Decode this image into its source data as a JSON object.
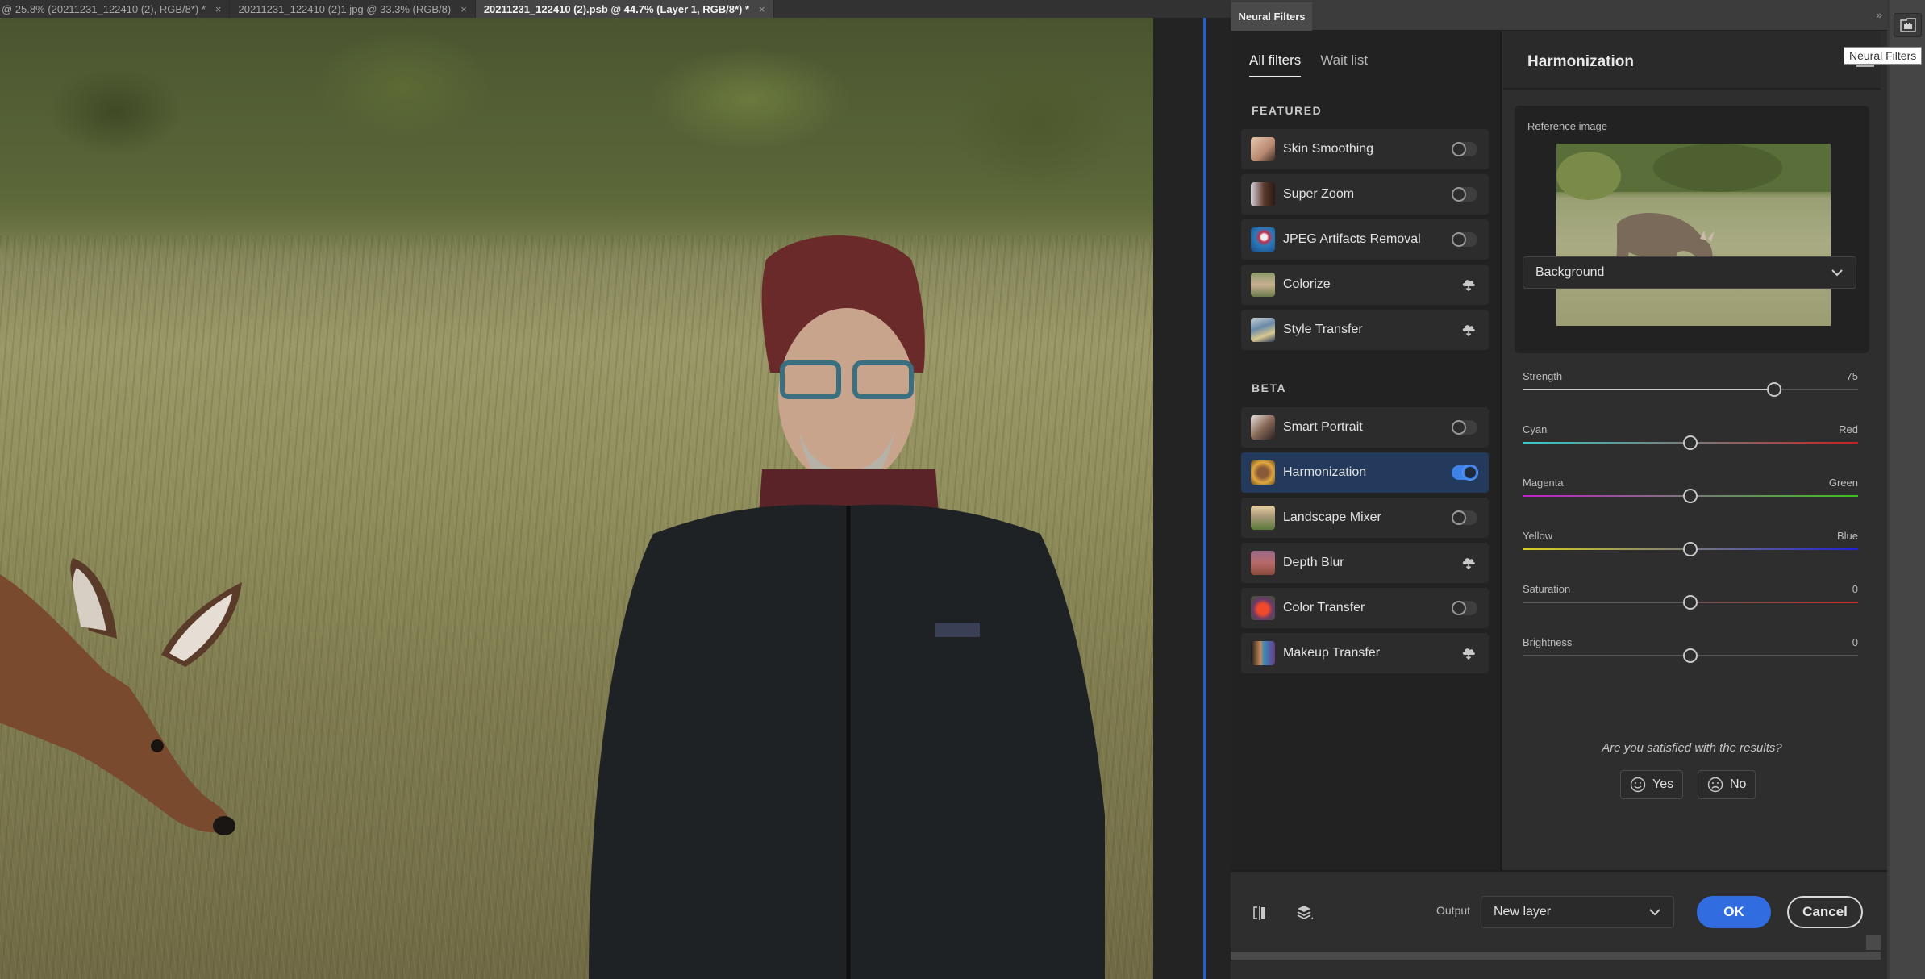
{
  "document_tabs": [
    {
      "label": "@ 25.8% (20211231_122410 (2), RGB/8*) *",
      "active": false
    },
    {
      "label": "20211231_122410 (2)1.jpg @ 33.3% (RGB/8)",
      "active": false
    },
    {
      "label": "20211231_122410 (2).psb @ 44.7% (Layer 1, RGB/8*) *",
      "active": true
    }
  ],
  "tab_close_glyph": "×",
  "panel": {
    "title": "Neural Filters",
    "collapse_glyph": "»",
    "tabs": {
      "all": "All filters",
      "waitlist": "Wait list"
    },
    "featured_label": "FEATURED",
    "beta_label": "BETA",
    "featured": [
      {
        "name": "Skin Smoothing",
        "control": "toggle",
        "on": false
      },
      {
        "name": "Super Zoom",
        "control": "toggle",
        "on": false
      },
      {
        "name": "JPEG Artifacts Removal",
        "control": "toggle",
        "on": false
      },
      {
        "name": "Colorize",
        "control": "cloud",
        "on": false
      },
      {
        "name": "Style Transfer",
        "control": "cloud",
        "on": false
      }
    ],
    "beta": [
      {
        "name": "Smart Portrait",
        "control": "toggle",
        "on": false
      },
      {
        "name": "Harmonization",
        "control": "toggle",
        "on": true,
        "selected": true
      },
      {
        "name": "Landscape Mixer",
        "control": "toggle",
        "on": false
      },
      {
        "name": "Depth Blur",
        "control": "cloud",
        "on": false
      },
      {
        "name": "Color Transfer",
        "control": "toggle",
        "on": false
      },
      {
        "name": "Makeup Transfer",
        "control": "cloud",
        "on": false
      }
    ]
  },
  "settings": {
    "title": "Harmonization",
    "reference_label": "Reference image",
    "layer_select": "Background",
    "sliders": [
      {
        "label": "Strength",
        "right": "75",
        "value": 0.75,
        "kind": "strength"
      },
      {
        "label": "Cyan",
        "right": "Red",
        "value": 0.5,
        "kind": "cyan-red"
      },
      {
        "label": "Magenta",
        "right": "Green",
        "value": 0.5,
        "kind": "magenta-green"
      },
      {
        "label": "Yellow",
        "right": "Blue",
        "value": 0.5,
        "kind": "yellow-blue"
      },
      {
        "label": "Saturation",
        "right": "0",
        "value": 0.5,
        "kind": "saturation"
      },
      {
        "label": "Brightness",
        "right": "0",
        "value": 0.5,
        "kind": "brightness"
      }
    ],
    "feedback_question": "Are you satisfied with the results?",
    "yes_label": "Yes",
    "no_label": "No"
  },
  "footer": {
    "output_label": "Output",
    "output_value": "New layer",
    "ok_label": "OK",
    "cancel_label": "Cancel"
  },
  "tooltip": "Neural Filters",
  "colors": {
    "accent": "#316de0",
    "selected_row": "#233a5c",
    "toggle_on": "#3f82e8"
  }
}
